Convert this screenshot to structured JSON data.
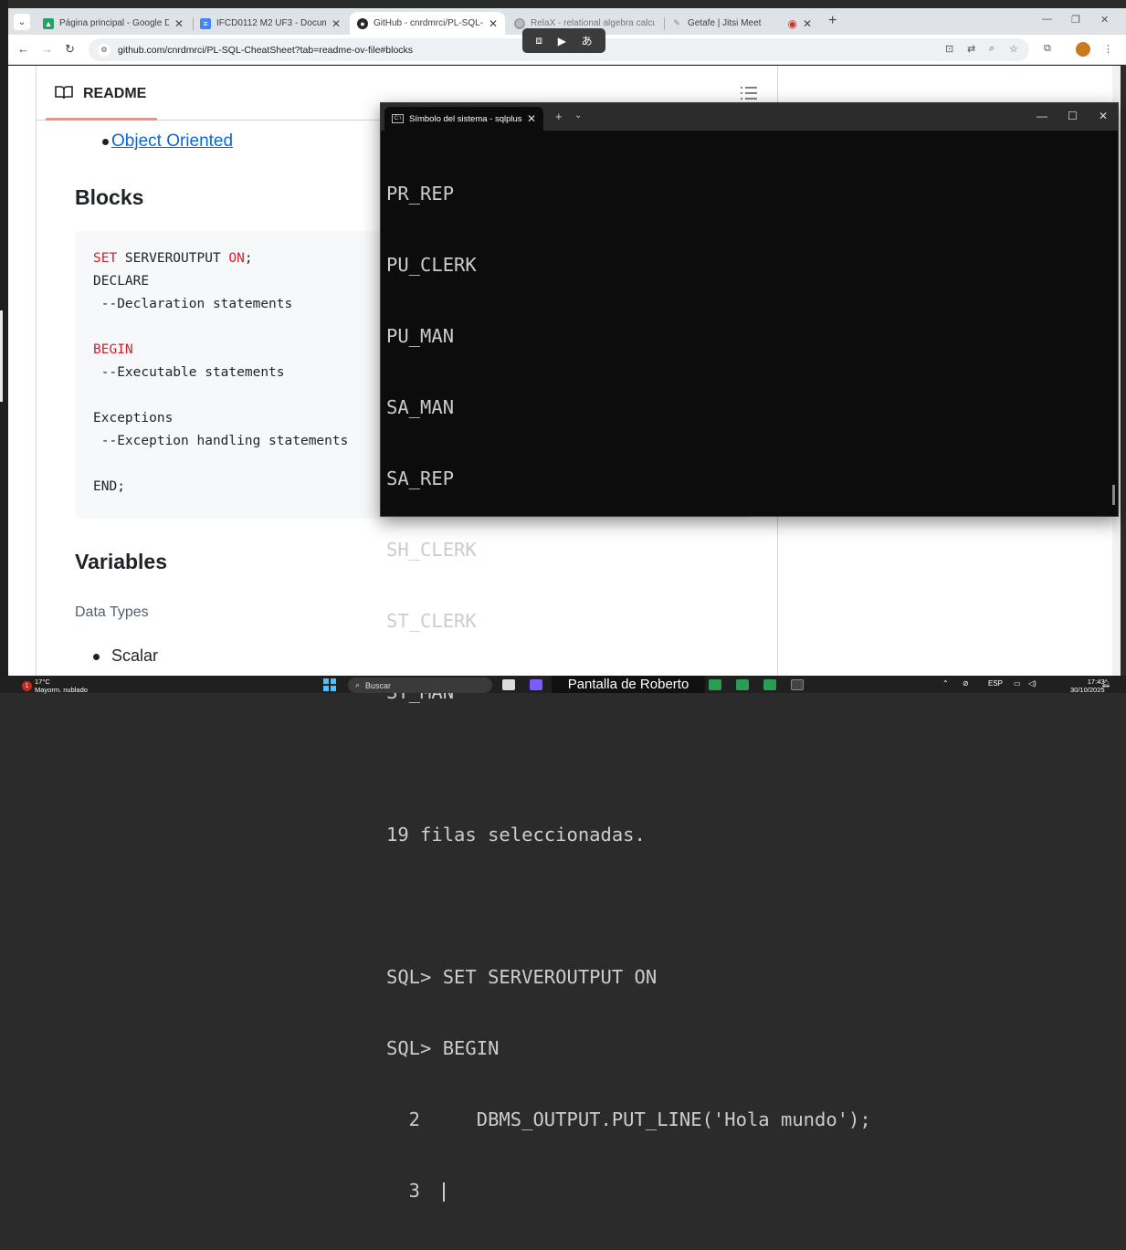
{
  "browser": {
    "tabs": [
      {
        "title": "Página principal - Google Drive",
        "icon": "google-drive-icon",
        "active": false
      },
      {
        "title": "IFCD0112 M2 UF3 - Documento",
        "icon": "docs-icon",
        "active": false
      },
      {
        "title": "GitHub - cnrdmrci/PL-SQL-Che",
        "icon": "github-icon",
        "active": true
      },
      {
        "title": "RelaX - relational algebra calcul",
        "icon": "relax-icon",
        "active": false
      },
      {
        "title": "Getafe | Jitsi Meet",
        "icon": "jitsi-icon",
        "active": false
      }
    ],
    "url": "github.com/cnrdmrci/PL-SQL-CheatSheet?tab=readme-ov-file#blocks"
  },
  "readme": {
    "header": "README",
    "link_object_oriented": "Object Oriented",
    "heading_blocks": "Blocks",
    "code_lines": {
      "l1_kw1": "SET",
      "l1_mid": " SERVEROUTPUT ",
      "l1_kw2": "ON",
      "l1_end": ";",
      "l2": "DECLARE",
      "l3": " --Declaration statements",
      "l5": "BEGIN",
      "l6": " --Executable statements",
      "l8": "Exceptions",
      "l9": " --Exception handling statements",
      "l11": "END;"
    },
    "heading_variables": "Variables",
    "data_types": "Data Types",
    "bullet_scalar": "Scalar"
  },
  "terminal": {
    "tab_title": "Símbolo del sistema - sqlplus",
    "lines": [
      "PR_REP",
      "PU_CLERK",
      "PU_MAN",
      "SA_MAN",
      "SA_REP",
      "SH_CLERK",
      "ST_CLERK",
      "ST_MAN",
      "",
      "19 filas seleccionadas.",
      "",
      "SQL> SET SERVEROUTPUT ON",
      "SQL> BEGIN",
      "  2     DBMS_OUTPUT.PUT_LINE('Hola mundo');",
      "  3  "
    ]
  },
  "taskbar": {
    "weather_temp": "17°C",
    "weather_desc": "Mayorm. nublado",
    "notification_count": "1",
    "search_placeholder": "Buscar",
    "screen_share_label": "Pantalla de Roberto",
    "lang": "ESP",
    "time": "17:43",
    "date": "30/10/2025"
  },
  "colors": {
    "keyword_red": "#cf222e",
    "link_blue": "#0969da",
    "terminal_bg": "#0c0c0c",
    "tab_underline": "#fd8c73"
  }
}
